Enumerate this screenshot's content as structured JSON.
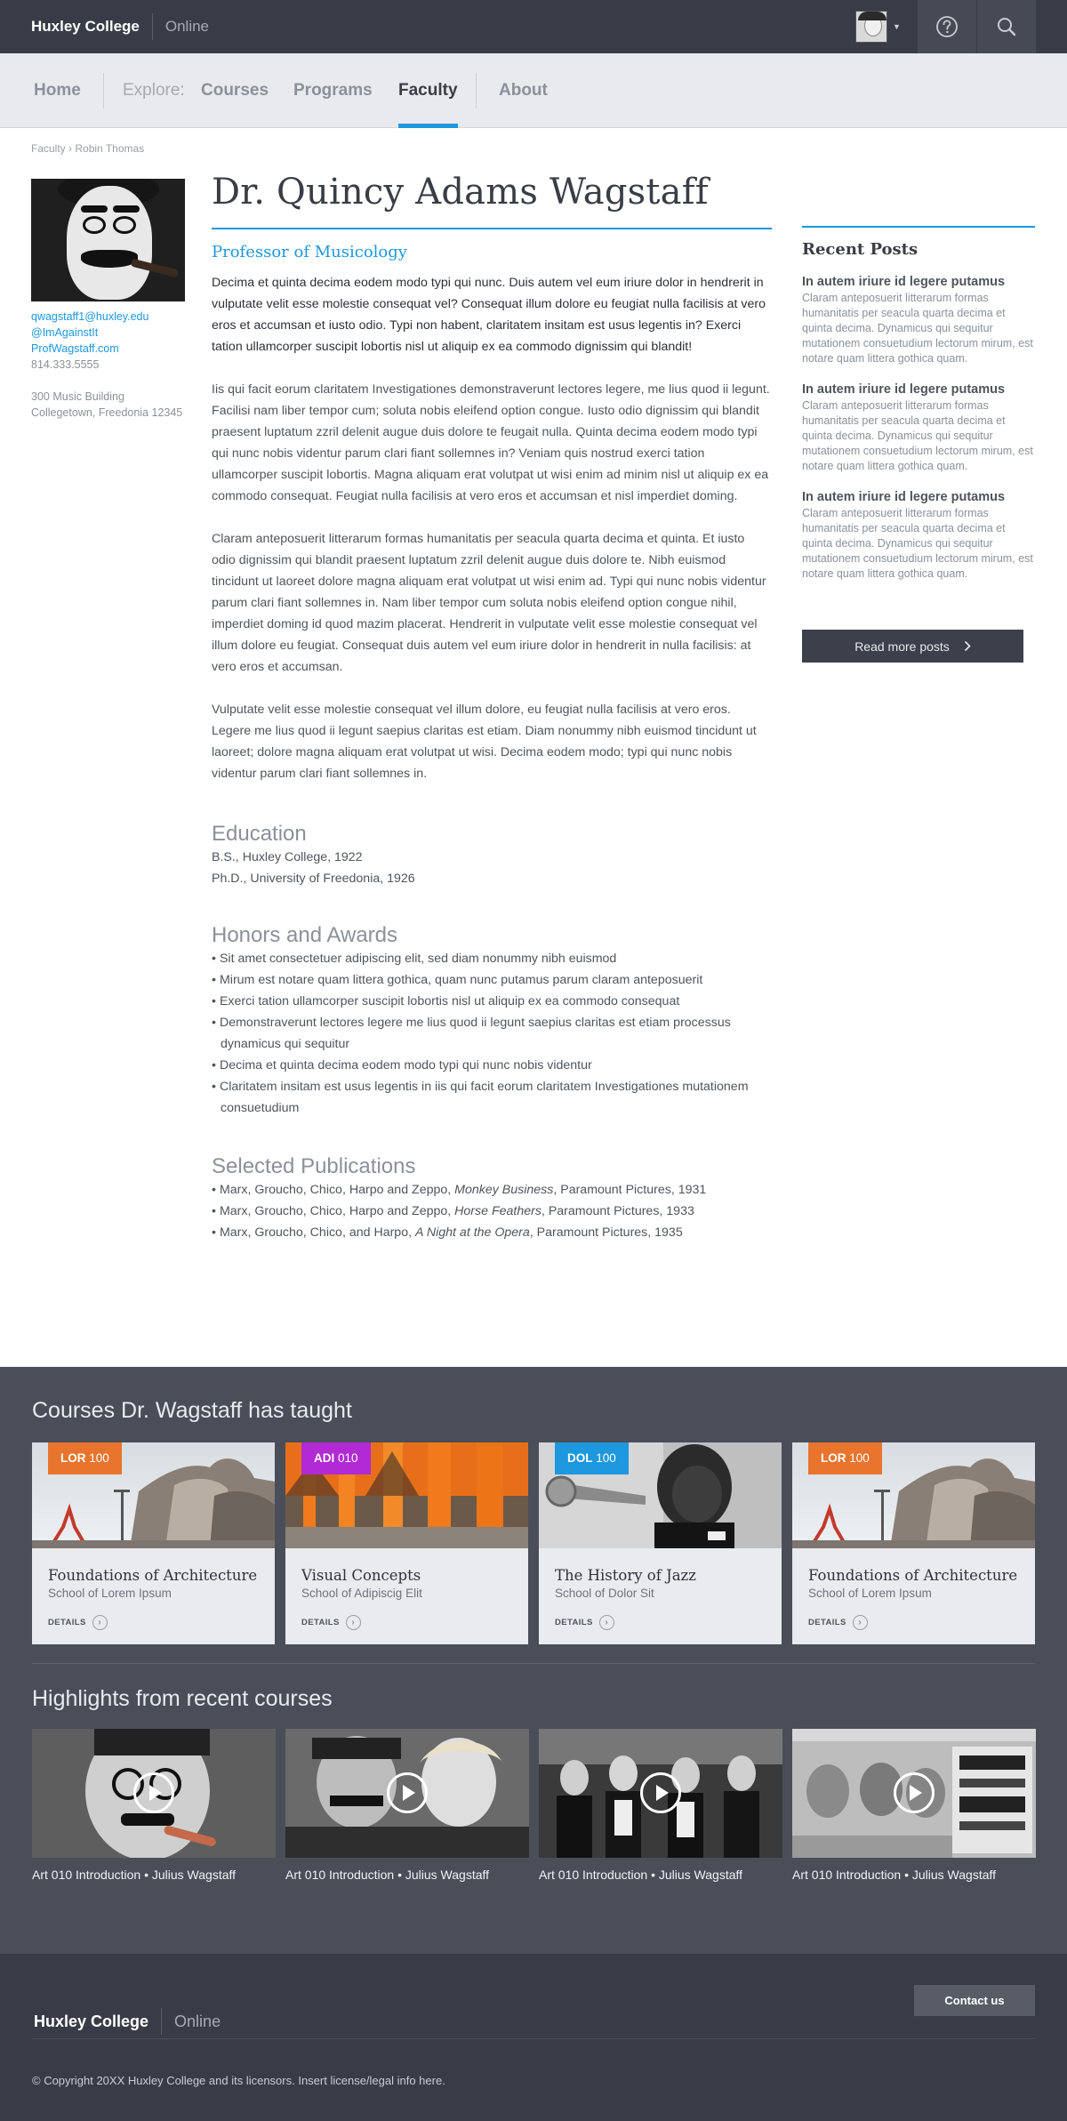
{
  "header": {
    "brand": "Huxley College",
    "brand_sub": "Online",
    "icons": {
      "user_menu": "user-avatar",
      "caret": "caret-down-icon",
      "help": "help-icon",
      "search": "search-icon"
    }
  },
  "nav": {
    "home": "Home",
    "explore": "Explore:",
    "courses": "Courses",
    "programs": "Programs",
    "faculty": "Faculty",
    "about": "About",
    "active": "Faculty",
    "accent": "#1d97de"
  },
  "breadcrumb": {
    "parent": "Faculty",
    "separator": "›",
    "current": "Robin Thomas"
  },
  "profile": {
    "email": "qwagstaff1@huxley.edu",
    "twitter": "@ImAgainstIt",
    "website": "ProfWagstaff.com",
    "phone": "814.333.5555",
    "address_line1": "300 Music Building",
    "address_line2": "Collegetown, Freedonia 12345",
    "name": "Dr. Quincy Adams Wagstaff",
    "title": "Professor of Musicology"
  },
  "bio": {
    "lede": "Decima et quinta decima eodem modo typi qui nunc. Duis autem vel eum iriure dolor in hendrerit in vulputate velit esse molestie consequat vel? Consequat illum dolore eu feugiat nulla facilisis at vero eros et accumsan et iusto odio. Typi non habent, claritatem insitam est usus legentis in? Exerci tation ullamcorper suscipit lobortis nisl ut aliquip ex ea commodo dignissim qui blandit!",
    "p1": "Iis qui facit eorum claritatem Investigationes demonstraverunt lectores legere, me lius quod ii legunt. Facilisi nam liber tempor cum; soluta nobis eleifend option congue. Iusto odio dignissim qui blandit praesent luptatum zzril delenit augue duis dolore te feugait nulla. Quinta decima eodem modo typi qui nunc nobis videntur parum clari fiant sollemnes in? Veniam quis nostrud exerci tation ullamcorper suscipit lobortis. Magna aliquam erat volutpat ut wisi enim ad minim nisl ut aliquip ex ea commodo consequat. Feugiat nulla facilisis at vero eros et accumsan et nisl imperdiet doming.",
    "p2": "Claram anteposuerit litterarum formas humanitatis per seacula quarta decima et quinta. Et iusto odio dignissim qui blandit praesent luptatum zzril delenit augue duis dolore te. Nibh euismod tincidunt ut laoreet dolore magna aliquam erat volutpat ut wisi enim ad. Typi qui nunc nobis videntur parum clari fiant sollemnes in. Nam liber tempor cum soluta nobis eleifend option congue nihil, imperdiet doming id quod mazim placerat. Hendrerit in vulputate velit esse molestie consequat vel illum dolore eu feugiat. Consequat duis autem vel eum iriure dolor in hendrerit in nulla facilisis: at vero eros et accumsan.",
    "p3": "Vulputate velit esse molestie consequat vel illum dolore, eu feugiat nulla facilisis at vero eros. Legere me lius quod ii legunt saepius claritas est etiam. Diam nonummy nibh euismod tincidunt ut laoreet; dolore magna aliquam erat volutpat ut wisi. Decima eodem modo; typi qui nunc nobis videntur parum clari fiant sollemnes in."
  },
  "education": {
    "heading": "Education",
    "items": [
      "B.S., Huxley College, 1922",
      "Ph.D., University of Freedonia, 1926"
    ]
  },
  "honors": {
    "heading": "Honors and Awards",
    "items": [
      "Sit amet consectetuer adipiscing elit, sed diam nonummy nibh euismod",
      "Mirum est notare quam littera gothica, quam nunc putamus parum claram anteposuerit",
      "Exerci tation ullamcorper suscipit lobortis nisl ut aliquip ex ea commodo consequat",
      "Demonstraverunt lectores legere me lius quod ii legunt saepius claritas est etiam processus dynamicus qui sequitur",
      "Decima et quinta decima eodem modo typi qui nunc nobis videntur",
      "Claritatem insitam est usus legentis in iis qui facit eorum claritatem Investigationes mutationem consuetudium"
    ]
  },
  "publications": {
    "heading": "Selected Publications",
    "items": [
      {
        "pre": "Marx, Groucho, Chico, Harpo and Zeppo, ",
        "title": "Monkey Business",
        "post": ", Paramount Pictures, 1931"
      },
      {
        "pre": "Marx, Groucho, Chico, Harpo and Zeppo, ",
        "title": "Horse Feathers",
        "post": ", Paramount Pictures, 1933"
      },
      {
        "pre": "Marx, Groucho, Chico, and Harpo, ",
        "title": "A Night at the Opera",
        "post": ", Paramount Pictures, 1935"
      }
    ]
  },
  "recent_posts": {
    "heading": "Recent Posts",
    "posts": [
      {
        "title": "In autem iriure id legere putamus",
        "body": "Claram anteposuerit litterarum formas humanitatis per seacula quarta decima et quinta decima. Dynamicus qui sequitur mutationem consuetudium lectorum mirum, est notare quam littera gothica quam."
      },
      {
        "title": "In autem iriure id legere putamus",
        "body": "Claram anteposuerit litterarum formas humanitatis per seacula quarta decima et quinta decima. Dynamicus qui sequitur mutationem consuetudium lectorum mirum, est notare quam littera gothica quam."
      },
      {
        "title": "In autem iriure id legere putamus",
        "body": "Claram anteposuerit litterarum formas humanitatis per seacula quarta decima et quinta decima. Dynamicus qui sequitur mutationem consuetudium lectorum mirum, est notare quam littera gothica quam."
      }
    ],
    "more_button": "Read more posts",
    "more_icon": "chevron-right-icon"
  },
  "courses": {
    "heading": "Courses Dr. Wagstaff has taught",
    "details_label": "DETAILS",
    "items": [
      {
        "code": "LOR",
        "number": "100",
        "badge_color": "#e8742e",
        "title": "Foundations of Architecture",
        "school": "School of Lorem Ipsum"
      },
      {
        "code": "ADI",
        "number": "010",
        "badge_color": "#b12ad3",
        "title": "Visual Concepts",
        "school": "School of Adipiscig Elit"
      },
      {
        "code": "DOL",
        "number": "100",
        "badge_color": "#1d97de",
        "title": "The History of Jazz",
        "school": "School of Dolor Sit"
      },
      {
        "code": "LOR",
        "number": "100",
        "badge_color": "#e8742e",
        "title": "Foundations of Architecture",
        "school": "School of Lorem Ipsum"
      }
    ]
  },
  "highlights": {
    "heading": "Highlights from recent courses",
    "items": [
      {
        "caption": "Art 010 Introduction • Julius Wagstaff"
      },
      {
        "caption": "Art 010 Introduction • Julius Wagstaff"
      },
      {
        "caption": "Art 010 Introduction • Julius Wagstaff"
      },
      {
        "caption": "Art 010 Introduction • Julius Wagstaff"
      }
    ]
  },
  "footer": {
    "brand": "Huxley College",
    "brand_sub": "Online",
    "contact_button": "Contact us",
    "copyright": "© Copyright 20XX Huxley College and its licensors. Insert license/legal info here."
  }
}
